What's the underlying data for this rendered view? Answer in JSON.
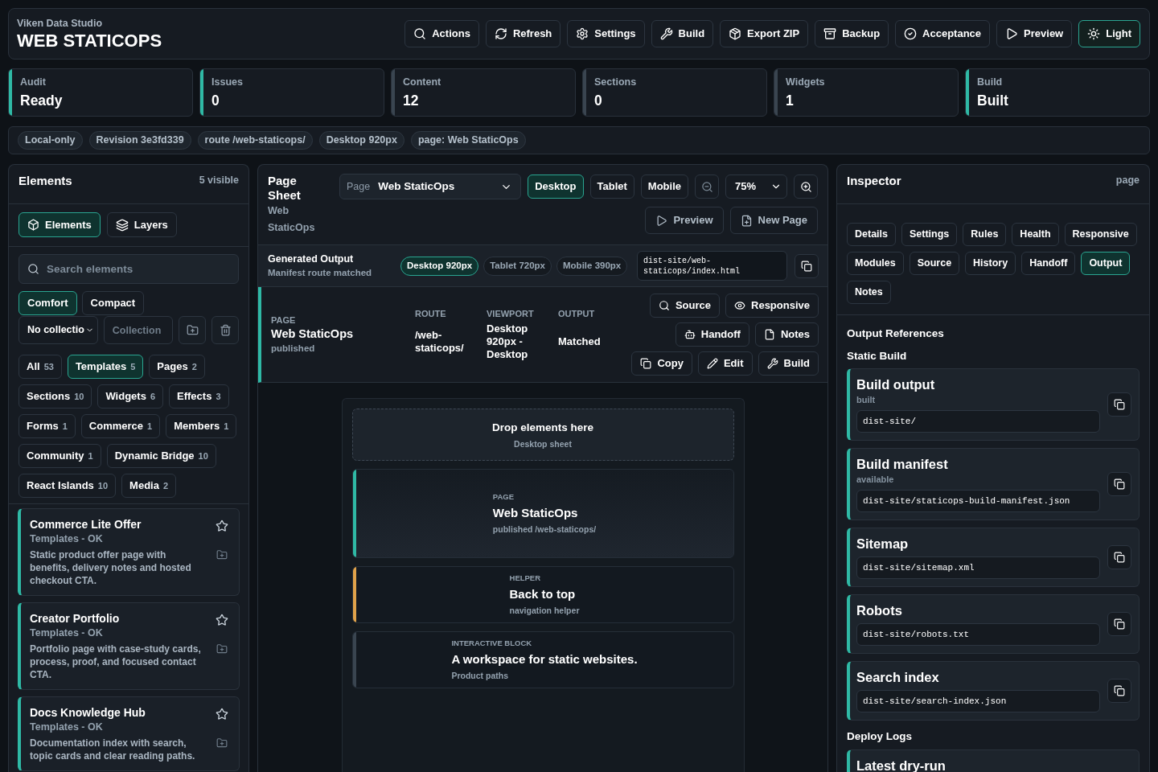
{
  "header": {
    "subtitle": "Viken Data Studio",
    "title": "WEB STATICOPS",
    "actions": [
      {
        "label": "Actions",
        "selected": false
      },
      {
        "label": "Refresh",
        "selected": false
      },
      {
        "label": "Settings",
        "selected": false
      },
      {
        "label": "Build",
        "selected": false
      },
      {
        "label": "Export ZIP",
        "selected": false
      },
      {
        "label": "Backup",
        "selected": false
      },
      {
        "label": "Acceptance",
        "selected": false
      },
      {
        "label": "Preview",
        "selected": false
      },
      {
        "label": "Light",
        "selected": true
      }
    ]
  },
  "stats": [
    {
      "label": "Audit",
      "value": "Ready",
      "color": "#2fb9a5"
    },
    {
      "label": "Issues",
      "value": "0",
      "color": "#2fb9a5"
    },
    {
      "label": "Content",
      "value": "12",
      "color": "#3a4550"
    },
    {
      "label": "Sections",
      "value": "0",
      "color": "#3a4550"
    },
    {
      "label": "Widgets",
      "value": "1",
      "color": "#3a4550"
    },
    {
      "label": "Build",
      "value": "Built",
      "color": "#2fb9a5"
    }
  ],
  "context_chips": [
    "Local-only",
    "Revision 3e3fd339",
    "route /web-staticops/",
    "Desktop 920px",
    "page: Web StaticOps"
  ],
  "elements_panel": {
    "title": "Elements",
    "count": "5 visible",
    "tabs": [
      {
        "label": "Elements",
        "selected": true
      },
      {
        "label": "Layers",
        "selected": false
      }
    ],
    "search": {
      "placeholder": "Search elements"
    },
    "density": [
      {
        "label": "Comfort",
        "selected": true
      },
      {
        "label": "Compact",
        "selected": false
      }
    ],
    "collection_select": {
      "value": "No collectio"
    },
    "collection_field": {
      "placeholder": "Collection"
    },
    "filters": [
      {
        "label": "All",
        "count": "53",
        "selected": false
      },
      {
        "label": "Templates",
        "count": "5",
        "selected": true
      },
      {
        "label": "Pages",
        "count": "2",
        "selected": false
      },
      {
        "label": "Sections",
        "count": "10",
        "selected": false
      },
      {
        "label": "Widgets",
        "count": "6",
        "selected": false
      },
      {
        "label": "Effects",
        "count": "3",
        "selected": false
      },
      {
        "label": "Forms",
        "count": "1",
        "selected": false
      },
      {
        "label": "Commerce",
        "count": "1",
        "selected": false
      },
      {
        "label": "Members",
        "count": "1",
        "selected": false
      },
      {
        "label": "Community",
        "count": "1",
        "selected": false
      },
      {
        "label": "Dynamic Bridge",
        "count": "10",
        "selected": false
      },
      {
        "label": "React Islands",
        "count": "10",
        "selected": false
      },
      {
        "label": "Media",
        "count": "2",
        "selected": false
      }
    ],
    "items": [
      {
        "title": "Commerce Lite Offer",
        "meta": "Templates - OK",
        "description": "Static product offer page with benefits, delivery notes and hosted checkout CTA."
      },
      {
        "title": "Creator Portfolio",
        "meta": "Templates - OK",
        "description": "Portfolio page with case-study cards, process, proof, and focused contact CTA."
      },
      {
        "title": "Docs Knowledge Hub",
        "meta": "Templates - OK",
        "description": "Documentation index with search, topic cards and clear reading paths."
      }
    ]
  },
  "page_sheet": {
    "title": "Page Sheet",
    "subtitle": "Web StaticOps",
    "page_select": {
      "label": "Page",
      "value": "Web StaticOps"
    },
    "viewports": [
      {
        "label": "Desktop",
        "selected": true
      },
      {
        "label": "Tablet",
        "selected": false
      },
      {
        "label": "Mobile",
        "selected": false
      }
    ],
    "zoom": {
      "value": "75%"
    },
    "actions": [
      "Preview",
      "New Page"
    ],
    "generated_output": {
      "title": "Generated Output",
      "status": "Manifest route matched",
      "sizes": [
        {
          "label": "Desktop 920px",
          "selected": true
        },
        {
          "label": "Tablet 720px",
          "selected": false
        },
        {
          "label": "Mobile 390px",
          "selected": false
        }
      ],
      "path": "dist-site/web-staticops/index.html"
    },
    "summary": {
      "page": {
        "label": "PAGE",
        "value": "Web StaticOps",
        "note": "published"
      },
      "fields": [
        {
          "label": "ROUTE",
          "value": "/web-staticops/"
        },
        {
          "label": "VIEWPORT",
          "value": "Desktop 920px - Desktop"
        },
        {
          "label": "OUTPUT",
          "value": "Matched"
        }
      ],
      "actions": [
        [
          "Source",
          "Responsive"
        ],
        [
          "Handoff",
          "Notes"
        ],
        [
          "Copy",
          "Edit",
          "Build"
        ]
      ]
    },
    "canvas": {
      "drop_zone": {
        "title": "Drop elements here",
        "subtitle": "Desktop sheet"
      },
      "blocks": [
        {
          "kind": "page",
          "label": "PAGE",
          "title": "Web StaticOps",
          "subtitle": "published /web-staticops/",
          "color": "#2fb9a5"
        },
        {
          "kind": "helper",
          "label": "HELPER",
          "title": "Back to top",
          "subtitle": "navigation helper",
          "color": "#e0a24a"
        },
        {
          "kind": "interactive",
          "label": "INTERACTIVE BLOCK",
          "title": "A workspace for static websites.",
          "subtitle": "Product paths",
          "color": "#3a4550"
        }
      ]
    }
  },
  "inspector": {
    "title": "Inspector",
    "scope": "page",
    "tabs": [
      {
        "label": "Details",
        "selected": false
      },
      {
        "label": "Settings",
        "selected": false
      },
      {
        "label": "Rules",
        "selected": false
      },
      {
        "label": "Health",
        "selected": false
      },
      {
        "label": "Responsive",
        "selected": false
      },
      {
        "label": "Modules",
        "selected": false
      },
      {
        "label": "Source",
        "selected": false
      },
      {
        "label": "History",
        "selected": false
      },
      {
        "label": "Handoff",
        "selected": false
      },
      {
        "label": "Output",
        "selected": true
      },
      {
        "label": "Notes",
        "selected": false
      }
    ],
    "section_title": "Output References",
    "groups": [
      {
        "title": "Static Build",
        "items": [
          {
            "title": "Build output",
            "status": "built",
            "path": "dist-site/"
          },
          {
            "title": "Build manifest",
            "status": "available",
            "path": "dist-site/staticops-build-manifest.json"
          },
          {
            "title": "Sitemap",
            "path": "dist-site/sitemap.xml"
          },
          {
            "title": "Robots",
            "path": "dist-site/robots.txt"
          },
          {
            "title": "Search index",
            "path": "dist-site/search-index.json"
          }
        ]
      },
      {
        "title": "Deploy Logs",
        "items": [
          {
            "title": "Latest dry-run"
          }
        ]
      }
    ]
  }
}
